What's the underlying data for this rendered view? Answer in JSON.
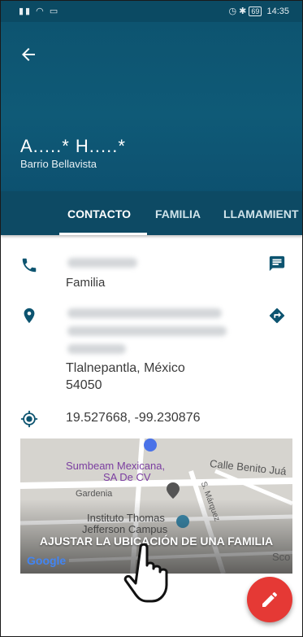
{
  "status_bar": {
    "left_icons": "signal wifi cast",
    "battery": "69",
    "time": "14:35"
  },
  "header": {
    "name": "A.....*  H.....*",
    "subtitle": "Barrio Bellavista"
  },
  "tabs": [
    {
      "label": "CONTACTO",
      "active": true
    },
    {
      "label": "FAMILIA",
      "active": false
    },
    {
      "label": "LLAMAMIENT",
      "active": false
    }
  ],
  "phone": {
    "type_label": "Familia"
  },
  "address": {
    "city_line": "Tlalnepantla, México",
    "postal_code": "54050"
  },
  "coordinates": "19.527668, -99.230876",
  "map": {
    "labels": {
      "sumbeam": "Sumbeam Mexicana,",
      "sumbeam2": "SA De CV",
      "benito": "Calle Benito Juá",
      "gardenia": "Gardenia",
      "marquez": "S. Márquez",
      "instituto": "Instituto Thomas",
      "jefferson": "Jefferson Campus",
      "sco": "Sco"
    },
    "action_text": "AJUSTAR LA UBICACIÓN DE UNA FAMILIA",
    "logo": "Google"
  },
  "colors": {
    "primary": "#0d5470",
    "fab": "#e53935"
  }
}
